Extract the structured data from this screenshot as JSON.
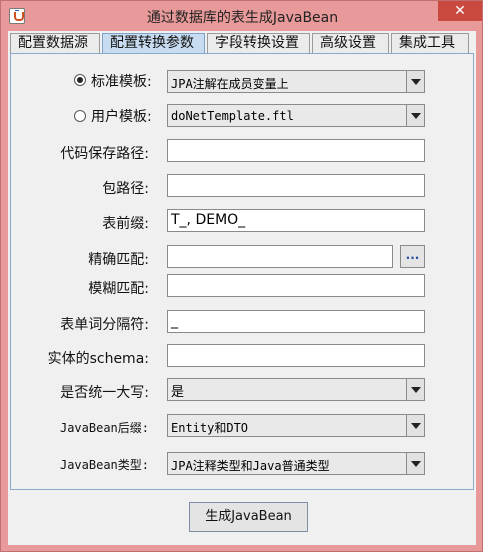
{
  "window": {
    "title": "通过数据库的表生成JavaBean",
    "close_glyph": "✕"
  },
  "tabs": [
    {
      "label": "配置数据源",
      "active": false
    },
    {
      "label": "配置转换参数",
      "active": true
    },
    {
      "label": "字段转换设置",
      "active": false
    },
    {
      "label": "高级设置",
      "active": false
    },
    {
      "label": "集成工具",
      "active": false
    }
  ],
  "form": {
    "standard_template": {
      "label": "标准模板:",
      "selected": true,
      "value": "JPA注解在成员变量上"
    },
    "user_template": {
      "label": "用户模板:",
      "selected": false,
      "value": "doNetTemplate.ftl"
    },
    "code_save_path": {
      "label": "代码保存路径:",
      "value": ""
    },
    "package_path": {
      "label": "包路径:",
      "value": ""
    },
    "table_prefix": {
      "label": "表前缀:",
      "value": "T_, DEMO_"
    },
    "exact_match": {
      "label": "精确匹配:",
      "value": "",
      "browse_label": "..."
    },
    "fuzzy_match": {
      "label": "模糊匹配:",
      "value": ""
    },
    "word_separator": {
      "label": "表单词分隔符:",
      "value": "_"
    },
    "entity_schema": {
      "label": "实体的schema:",
      "value": ""
    },
    "uppercase": {
      "label": "是否统一大写:",
      "value": "是"
    },
    "bean_suffix": {
      "label": "JavaBean后缀:",
      "value": "Entity和DTO"
    },
    "bean_type": {
      "label": "JavaBean类型:",
      "value": "JPA注释类型和Java普通类型"
    }
  },
  "actions": {
    "generate_label": "生成JavaBean"
  }
}
